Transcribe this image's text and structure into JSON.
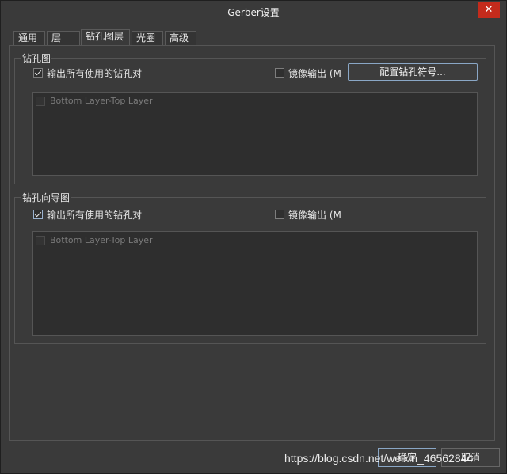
{
  "window": {
    "title": "Gerber设置",
    "close_glyph": "✕"
  },
  "tabs": [
    {
      "label": "通用"
    },
    {
      "label": "层"
    },
    {
      "label": "钻孔图层"
    },
    {
      "label": "光圈"
    },
    {
      "label": "高级"
    }
  ],
  "drill_drawing": {
    "title": "钻孔图",
    "output_all_label": "输出所有使用的钻孔对",
    "output_all_checked": true,
    "mirror_label": "镜像输出 (M",
    "mirror_checked": false,
    "config_button": "配置钻孔符号...",
    "layers": [
      {
        "label": "Bottom Layer-Top Layer",
        "checked": false
      }
    ]
  },
  "drill_guide": {
    "title": "钻孔向导图",
    "output_all_label": "输出所有使用的钻孔对",
    "output_all_checked": true,
    "mirror_label": "镜像输出 (M",
    "mirror_checked": false,
    "layers": [
      {
        "label": "Bottom Layer-Top Layer",
        "checked": false
      }
    ]
  },
  "footer": {
    "ok_label": "确定",
    "cancel_label": "取消",
    "watermark": "https://blog.csdn.net/weixin_46562844"
  }
}
